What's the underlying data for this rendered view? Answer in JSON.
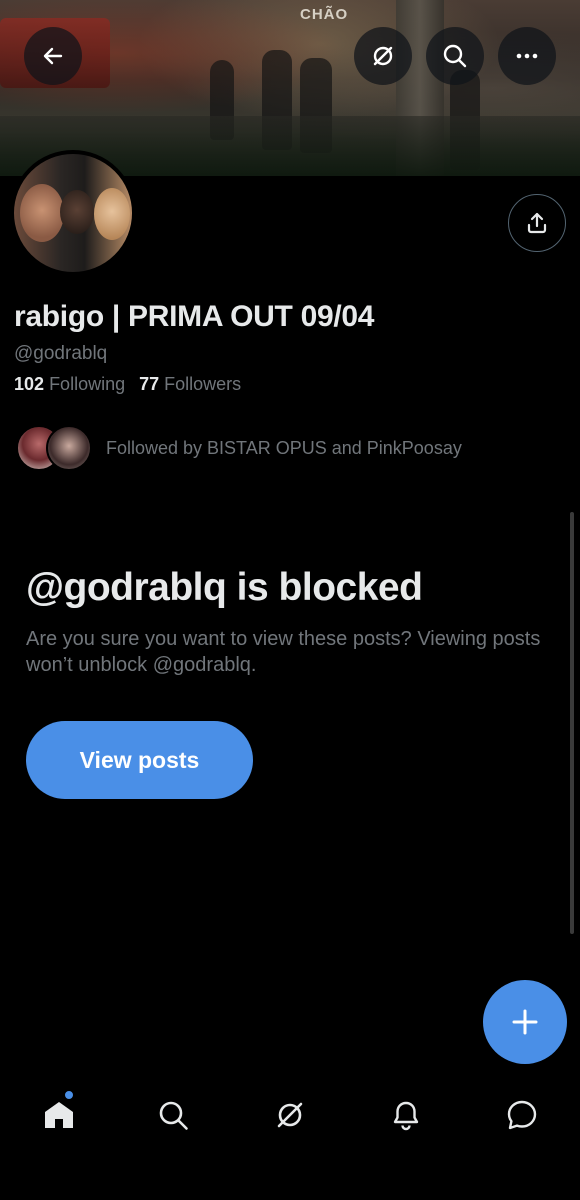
{
  "header": {
    "banner_sign": "CHÃO",
    "back_icon": "arrow-left-icon",
    "grok_icon": "grok-icon",
    "search_icon": "search-icon",
    "more_icon": "more-dots-icon"
  },
  "profile": {
    "display_name": "rabigo | PRIMA OUT 09/04",
    "handle": "@godrablq",
    "following_count": "102",
    "following_label": "Following",
    "followers_count": "77",
    "followers_label": "Followers",
    "followed_by": "Followed by BISTAR OPUS and PinkPoosay",
    "share_icon": "share-upload-icon"
  },
  "blocked": {
    "title": "@godrablq is blocked",
    "description": "Are you sure you want to view these posts? Viewing posts won’t unblock @godrablq.",
    "button_label": "View posts"
  },
  "fab": {
    "icon": "plus-icon"
  },
  "bottom_nav": {
    "items": [
      {
        "name": "home",
        "icon": "home-icon",
        "active": true,
        "has_badge": true
      },
      {
        "name": "search",
        "icon": "search-icon"
      },
      {
        "name": "grok",
        "icon": "grok-icon"
      },
      {
        "name": "notifications",
        "icon": "bell-icon"
      },
      {
        "name": "messages",
        "icon": "chat-bubble-icon"
      }
    ]
  },
  "colors": {
    "background": "#000000",
    "accent": "#4a8fe7",
    "primary_text": "#e7e9ea",
    "secondary_text": "#71767b"
  }
}
